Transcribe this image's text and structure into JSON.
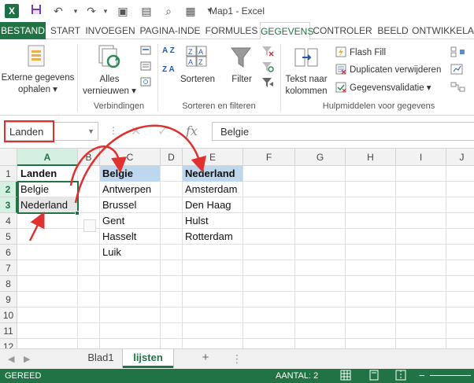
{
  "window": {
    "title": "Map1 - Excel",
    "app_icon": "X"
  },
  "tabs": [
    "BESTAND",
    "START",
    "INVOEGEN",
    "PAGINA-INDE",
    "FORMULES",
    "GEGEVENS",
    "CONTROLER",
    "BEELD",
    "ONTWIKKELA"
  ],
  "active_tab": "GEGEVENS",
  "ribbon": {
    "ext_data": {
      "line1": "Externe gegevens",
      "line2": "ophalen ▾"
    },
    "refresh": {
      "line1": "Alles",
      "line2": "vernieuwen ▾"
    },
    "group_connections": "Verbindingen",
    "sort": "Sorteren",
    "filter": "Filter",
    "group_sort": "Sorteren en filteren",
    "text_columns": {
      "line1": "Tekst naar",
      "line2": "kolommen"
    },
    "flash_fill": "Flash Fill",
    "remove_duplicates": "Duplicaten verwijderen",
    "data_validation": "Gegevensvalidatie ▾",
    "group_tools": "Hulpmiddelen voor gegevens",
    "sort_az": "A Z",
    "sort_za": "Z A"
  },
  "formula_bar": {
    "name_box": "Landen",
    "value": "Belgie",
    "fx": "fx"
  },
  "columns": [
    "A",
    "B",
    "C",
    "D",
    "E",
    "F",
    "G",
    "H",
    "I",
    "J"
  ],
  "selected_column": "A",
  "rows": [
    "1",
    "2",
    "3",
    "4",
    "5",
    "6",
    "7",
    "8",
    "9",
    "10",
    "11",
    "12"
  ],
  "selected_rows": [
    "2",
    "3"
  ],
  "cells": {
    "A1": "Landen",
    "A2": "Belgie",
    "A3": "Nederland",
    "C1": "Belgie",
    "C2": "Antwerpen",
    "C3": "Brussel",
    "C4": "Gent",
    "C5": "Hasselt",
    "C6": "Luik",
    "E1": "Nederland",
    "E2": "Amsterdam",
    "E3": "Den Haag",
    "E4": "Hulst",
    "E5": "Rotterdam"
  },
  "sheets": [
    {
      "name": "Blad1",
      "active": false
    },
    {
      "name": "lijsten",
      "active": true
    }
  ],
  "add_sheet": "+",
  "status": {
    "mode": "GEREED",
    "count": "AANTAL: 2"
  },
  "colors": {
    "excel_green": "#217346",
    "header_highlight": "#bdd7ee",
    "annotation_red": "#e03131"
  }
}
